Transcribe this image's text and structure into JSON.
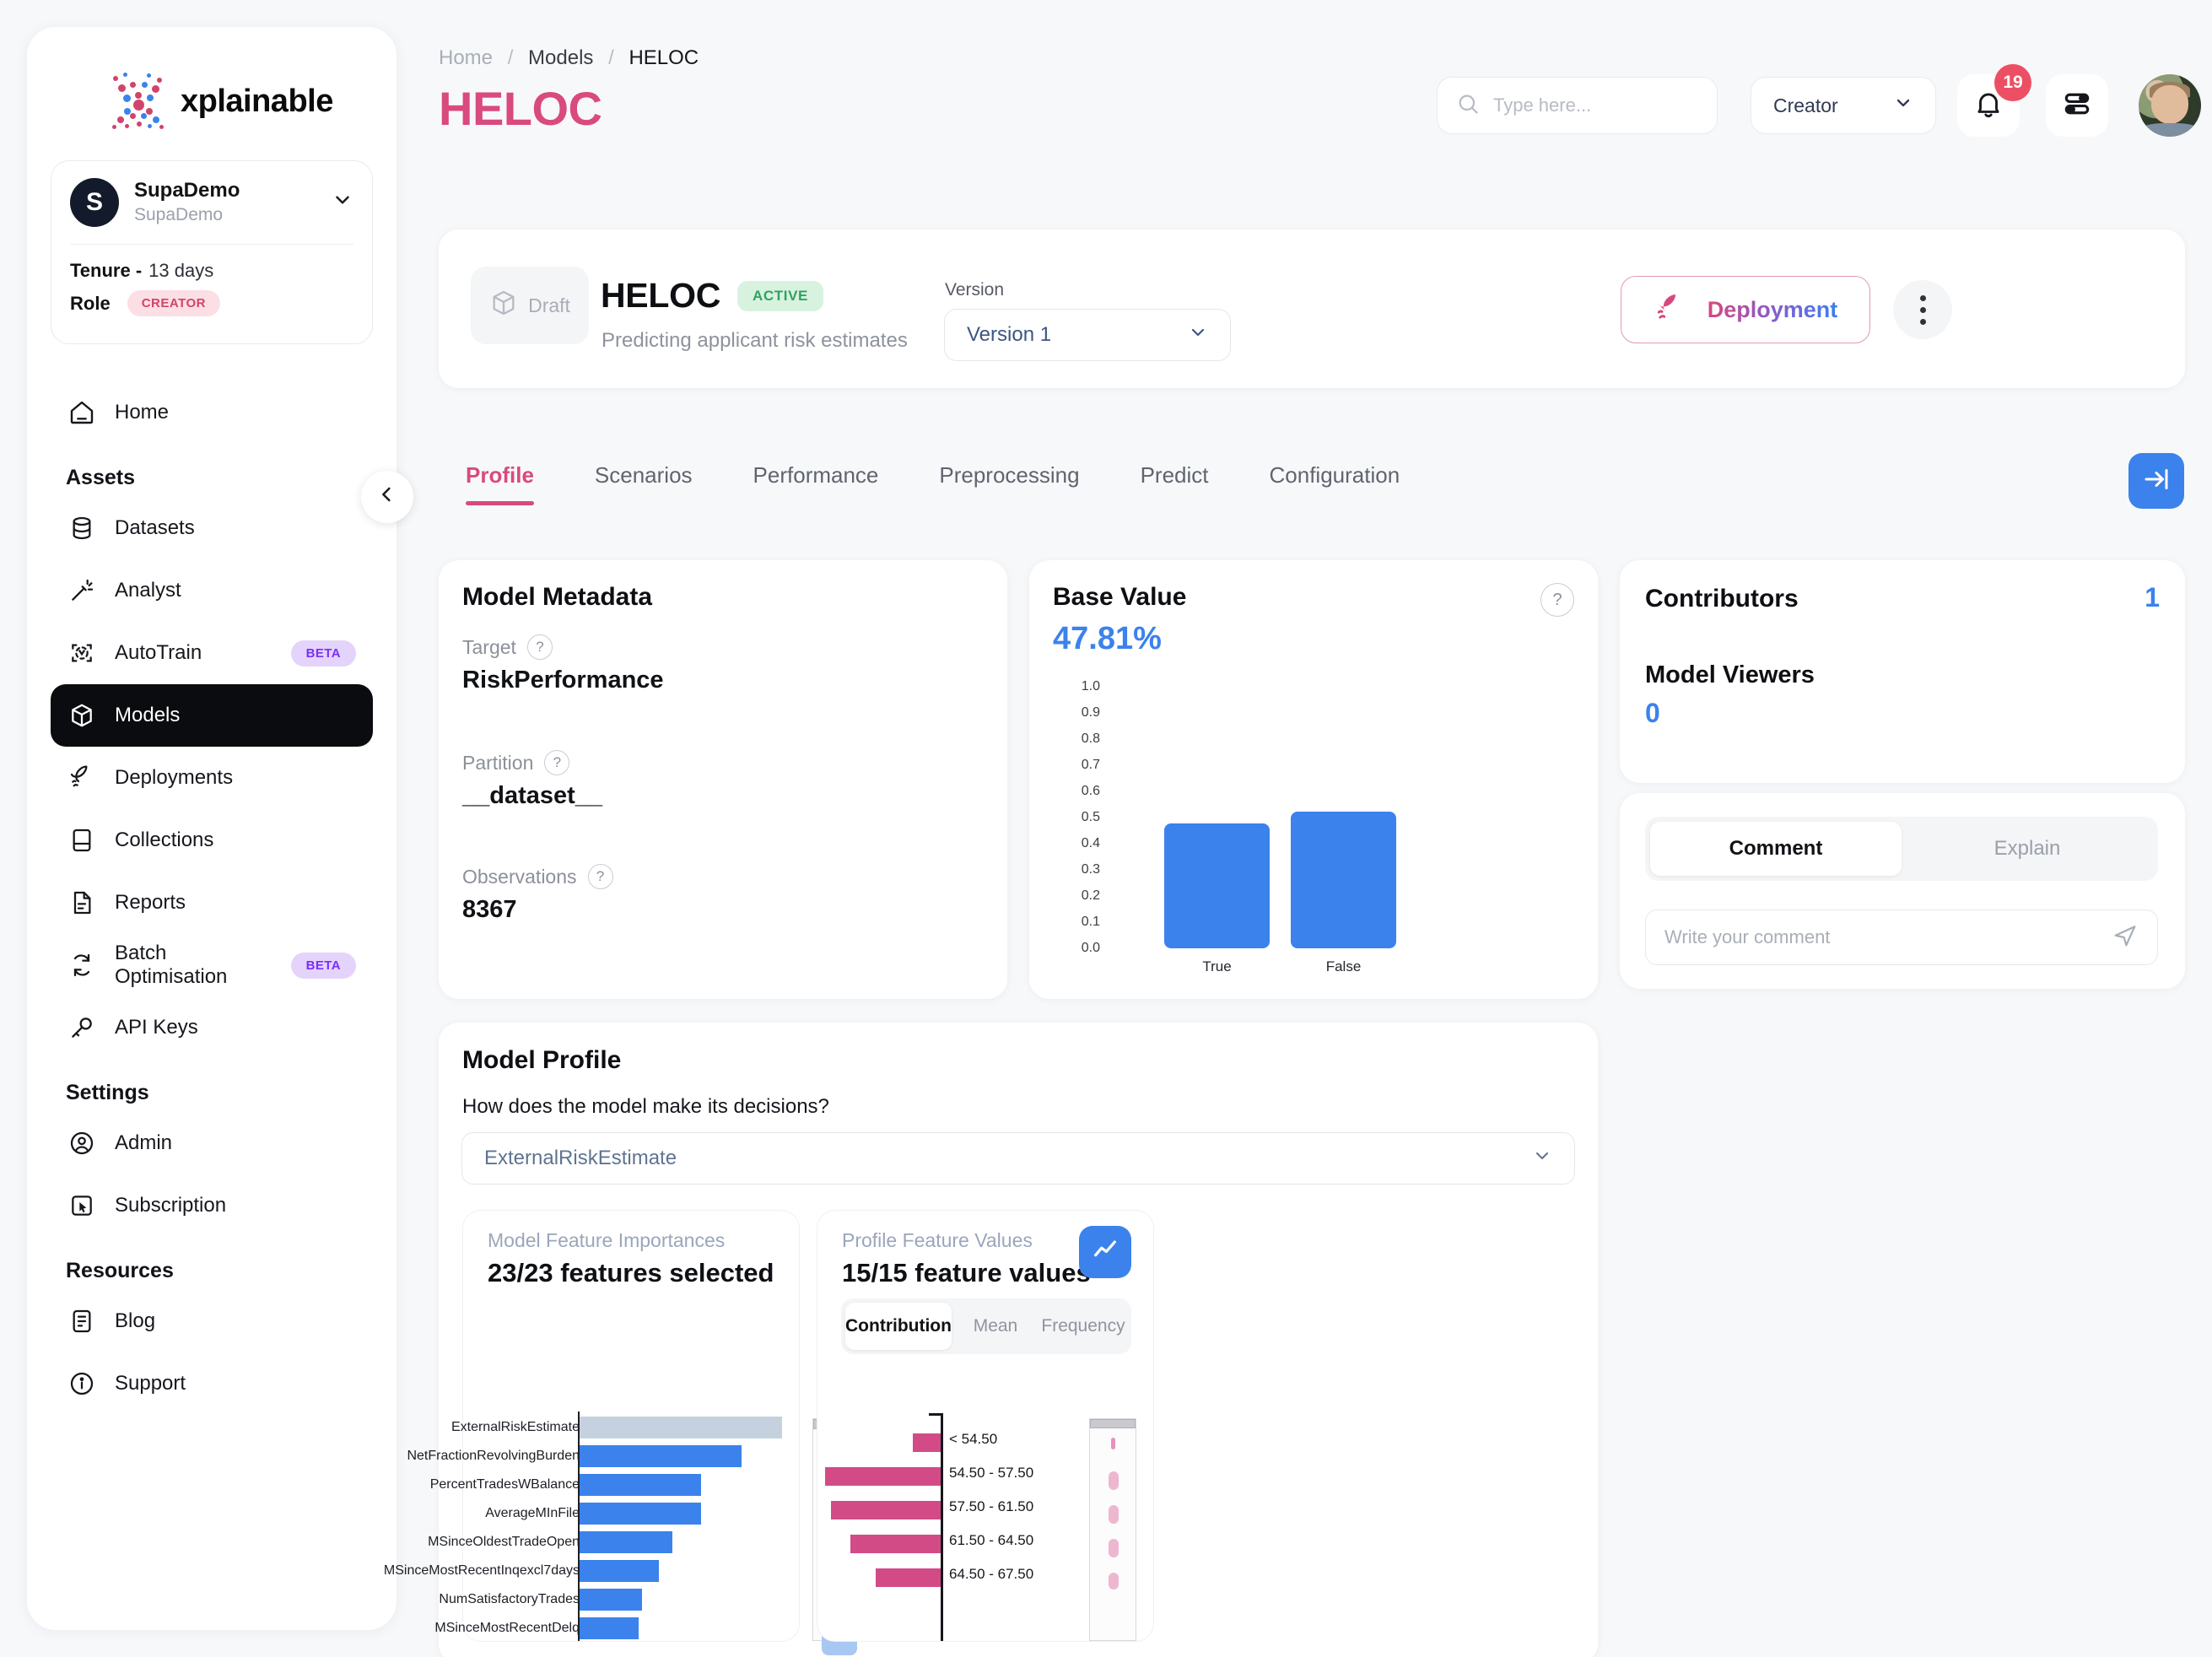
{
  "brand": {
    "name": "xplainable",
    "accent_pink": "#d94a7e",
    "accent_blue": "#3b82ec",
    "logo_icon": "x-dots-logo"
  },
  "org": {
    "avatar_letter": "S",
    "name": "SupaDemo",
    "sub": "SupaDemo",
    "tenure_key": "Tenure -",
    "tenure_value": "13 days",
    "role_key": "Role",
    "role_badge": "CREATOR",
    "chevron": "chevron-down-icon"
  },
  "sidebar": {
    "collapse_icon": "chevron-left-icon",
    "top_items": [
      {
        "label": "Home",
        "icon": "home-icon",
        "active": false,
        "badge": null
      }
    ],
    "sections": [
      {
        "title": "Assets",
        "items": [
          {
            "label": "Datasets",
            "icon": "database-icon",
            "active": false,
            "badge": null
          },
          {
            "label": "Analyst",
            "icon": "magic-wand-icon",
            "active": false,
            "badge": "BETA"
          },
          {
            "label": "AutoTrain",
            "icon": "autotrain-icon",
            "active": false,
            "badge": "BETA"
          },
          {
            "label": "Models",
            "icon": "cube-icon",
            "active": true,
            "badge": null
          },
          {
            "label": "Deployments",
            "icon": "rocket-icon",
            "active": false,
            "badge": null
          },
          {
            "label": "Collections",
            "icon": "collection-icon",
            "active": false,
            "badge": null
          },
          {
            "label": "Reports",
            "icon": "report-icon",
            "active": false,
            "badge": null
          },
          {
            "label": "Batch Optimisation",
            "icon": "refresh-icon",
            "active": false,
            "badge": "BETA"
          },
          {
            "label": "API Keys",
            "icon": "key-icon",
            "active": false,
            "badge": null
          }
        ]
      },
      {
        "title": "Settings",
        "items": [
          {
            "label": "Admin",
            "icon": "user-circle-icon",
            "active": false,
            "badge": null
          },
          {
            "label": "Subscription",
            "icon": "cursor-box-icon",
            "active": false,
            "badge": null
          }
        ]
      },
      {
        "title": "Resources",
        "items": [
          {
            "label": "Blog",
            "icon": "blog-icon",
            "active": false,
            "badge": null
          },
          {
            "label": "Support",
            "icon": "info-icon",
            "active": false,
            "badge": null
          }
        ]
      }
    ]
  },
  "topbar": {
    "breadcrumb": {
      "level0": "Home",
      "level1": "Models",
      "level2": "HELOC",
      "separator": "/"
    },
    "page_title": "HELOC",
    "search": {
      "placeholder": "Type here...",
      "value": "",
      "icon": "search-icon"
    },
    "role_select": {
      "value": "Creator",
      "icon": "chevron-down-icon"
    },
    "notifications": {
      "icon": "bell-icon",
      "count": "19"
    },
    "settings": {
      "icon": "sliders-icon"
    },
    "avatar": {
      "icon": "user-avatar"
    }
  },
  "model_header": {
    "draft_label": "Draft",
    "draft_icon": "cube-outline-icon",
    "name": "HELOC",
    "status_badge": "ACTIVE",
    "description": "Predicting applicant risk estimates",
    "version_label": "Version",
    "version_value": "Version 1",
    "deploy_label": "Deployment",
    "deploy_icon": "rocket-icon",
    "more_icon": "kebab-menu-icon"
  },
  "tabs": {
    "items": [
      {
        "label": "Profile",
        "active": true
      },
      {
        "label": "Scenarios",
        "active": false
      },
      {
        "label": "Performance",
        "active": false
      },
      {
        "label": "Preprocessing",
        "active": false
      },
      {
        "label": "Predict",
        "active": false
      },
      {
        "label": "Configuration",
        "active": false
      }
    ],
    "expand_icon": "arrow-right-to-line-icon"
  },
  "metadata_card": {
    "title": "Model Metadata",
    "fields": [
      {
        "key": "Target",
        "value": "RiskPerformance",
        "help": "?"
      },
      {
        "key": "Partition",
        "value": "__dataset__",
        "help": "?"
      },
      {
        "key": "Observations",
        "value": "8367",
        "help": "?"
      }
    ]
  },
  "base_value_card": {
    "title": "Base Value",
    "help": "?",
    "value": "47.81%"
  },
  "contributors_card": {
    "contributors_label": "Contributors",
    "contributors_value": "1",
    "viewers_label": "Model Viewers",
    "viewers_value": "0"
  },
  "comment_card": {
    "tabs": [
      {
        "label": "Comment",
        "active": true
      },
      {
        "label": "Explain",
        "active": false
      }
    ],
    "input_placeholder": "Write your comment",
    "input_value": "",
    "send_icon": "send-icon"
  },
  "model_profile": {
    "title": "Model Profile",
    "question": "How does the model make its decisions?",
    "feature_select_value": "ExternalRiskEstimate",
    "feature_select_icon": "chevron-down-icon",
    "importances_panel": {
      "subtitle": "Model Feature Importances",
      "headline": "23/23 features selected"
    },
    "values_panel": {
      "subtitle": "Profile Feature Values",
      "headline": "15/15 feature values",
      "chart_toggle_icon": "line-chart-icon",
      "tabs": [
        {
          "label": "Contribution",
          "active": true
        },
        {
          "label": "Mean",
          "active": false
        },
        {
          "label": "Frequency",
          "active": false
        }
      ]
    }
  },
  "chart_data": [
    {
      "type": "bar",
      "id": "base-value-chart",
      "title": "Base Value",
      "categories": [
        "True",
        "False"
      ],
      "values": [
        0.478,
        0.522
      ],
      "ylim": [
        0.0,
        1.0
      ],
      "yticks": [
        "1.0",
        "0.9",
        "0.8",
        "0.7",
        "0.6",
        "0.5",
        "0.4",
        "0.3",
        "0.2",
        "0.1",
        "0.0"
      ],
      "xlabel": "",
      "ylabel": "",
      "grid": false,
      "legend": "none",
      "series_color": "#3b82ec"
    },
    {
      "type": "bar",
      "id": "model-feature-importances",
      "title": "Model Feature Importances",
      "orientation": "horizontal",
      "categories": [
        "ExternalRiskEstimate",
        "NetFractionRevolvingBurden",
        "PercentTradesWBalance",
        "AverageMInFile",
        "MSinceOldestTradeOpen",
        "MSinceMostRecentInqexcl7days",
        "NumSatisfactoryTrades",
        "MSinceMostRecentDelq"
      ],
      "values": [
        1.0,
        0.8,
        0.6,
        0.6,
        0.46,
        0.39,
        0.31,
        0.29
      ],
      "highlight_index": 0,
      "highlight_color": "#c6d1e0",
      "series_color": "#3b82ec",
      "grid": false,
      "legend": "none"
    },
    {
      "type": "bar",
      "id": "profile-feature-values",
      "title": "Profile Feature Values",
      "orientation": "horizontal",
      "direction": "negative",
      "categories": [
        "< 54.50",
        "54.50 - 57.50",
        "57.50 - 61.50",
        "61.50 - 64.50",
        "64.50 - 67.50"
      ],
      "values": [
        -0.1,
        -0.41,
        -0.39,
        -0.32,
        -0.23
      ],
      "series_color": "#d24b87",
      "grid": false,
      "legend": "none"
    }
  ]
}
